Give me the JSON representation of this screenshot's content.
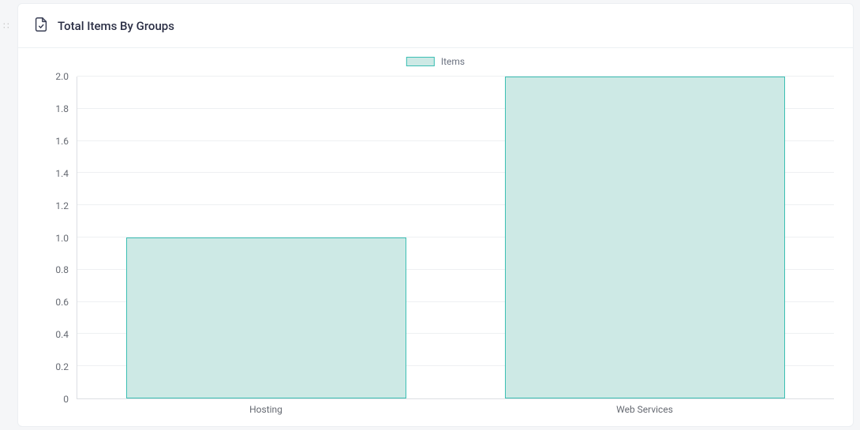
{
  "card": {
    "title": "Total Items By Groups",
    "icon": "document-check-icon"
  },
  "legend": {
    "series_label": "Items"
  },
  "chart_data": {
    "type": "bar",
    "categories": [
      "Hosting",
      "Web Services"
    ],
    "series": [
      {
        "name": "Items",
        "values": [
          1,
          2
        ]
      }
    ],
    "title": "Total Items By Groups",
    "xlabel": "",
    "ylabel": "",
    "ylim": [
      0,
      2
    ],
    "yticks": [
      0,
      0.2,
      0.4,
      0.6,
      0.8,
      1.0,
      1.2,
      1.4,
      1.6,
      1.8,
      2.0
    ],
    "ytick_labels": [
      "0",
      "0.2",
      "0.4",
      "0.6",
      "0.8",
      "1.0",
      "1.2",
      "1.4",
      "1.6",
      "1.8",
      "2.0"
    ],
    "colors": {
      "bar_fill": "#cde9e5",
      "bar_border": "#3cbfb4"
    }
  }
}
